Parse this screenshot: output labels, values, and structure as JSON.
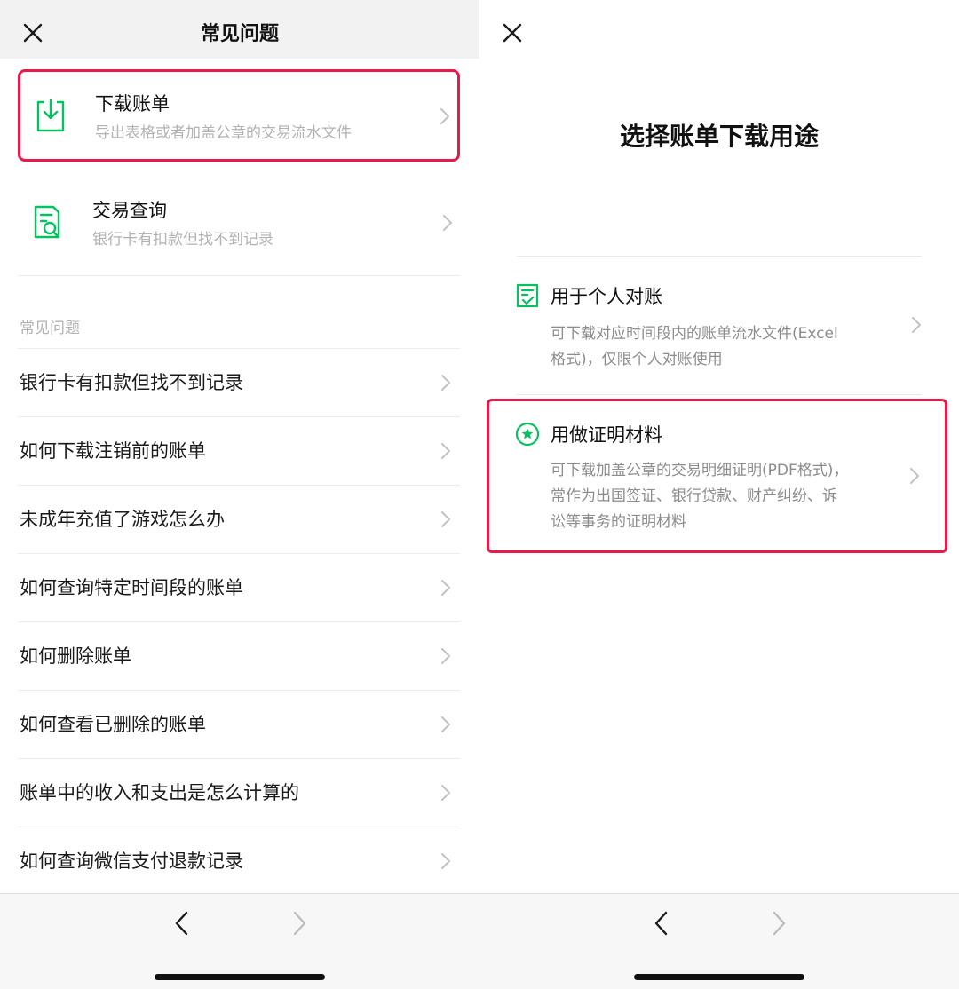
{
  "left": {
    "header": {
      "title": "常见问题"
    },
    "cards": [
      {
        "title": "下载账单",
        "subtitle": "导出表格或者加盖公章的交易流水文件"
      },
      {
        "title": "交易查询",
        "subtitle": "银行卡有扣款但找不到记录"
      }
    ],
    "section_label": "常见问题",
    "faq": [
      "银行卡有扣款但找不到记录",
      "如何下载注销前的账单",
      "未成年充值了游戏怎么办",
      "如何查询特定时间段的账单",
      "如何删除账单",
      "如何查看已删除的账单",
      "账单中的收入和支出是怎么计算的",
      "如何查询微信支付退款记录"
    ]
  },
  "right": {
    "title": "选择账单下载用途",
    "options": [
      {
        "title": "用于个人对账",
        "desc_lines": [
          "可下载对应时间段内的账单流水文件(Excel",
          "格式)，仅限个人对账使用"
        ]
      },
      {
        "title": "用做证明材料",
        "desc_lines": [
          "可下载加盖公章的交易明细证明(PDF格式)，",
          "常作为出国签证、银行贷款、财产纠纷、诉",
          "讼等事务的证明材料"
        ]
      }
    ]
  },
  "colors": {
    "accent_green": "#07c160",
    "highlight_red": "#e8194b"
  },
  "icons": [
    "close-icon",
    "download-icon",
    "search-document-icon",
    "chevron-right-icon",
    "back-arrow-icon",
    "forward-arrow-icon",
    "checklist-icon",
    "star-circle-icon"
  ]
}
